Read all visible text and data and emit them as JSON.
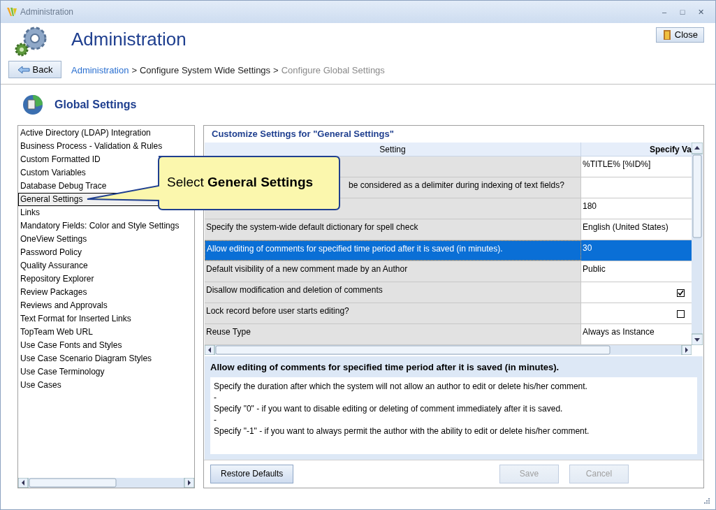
{
  "window": {
    "title": "Administration",
    "buttons": [
      "–",
      "□",
      "✕"
    ]
  },
  "header": {
    "title": "Administration",
    "close_button": "Close",
    "back_button": "Back"
  },
  "breadcrumb": [
    {
      "label": "Administration",
      "kind": "link"
    },
    {
      "label": ">",
      "kind": "sep"
    },
    {
      "label": "Configure System Wide Settings",
      "kind": "text"
    },
    {
      "label": ">",
      "kind": "sep"
    },
    {
      "label": "Configure Global Settings",
      "kind": "current"
    }
  ],
  "section_title": "Global Settings",
  "sidebar": {
    "items": [
      {
        "label": "Active Directory (LDAP) Integration",
        "selected": false
      },
      {
        "label": "Business Process - Validation & Rules",
        "selected": false
      },
      {
        "label": "Custom Formatted ID",
        "selected": false
      },
      {
        "label": "Custom Variables",
        "selected": false
      },
      {
        "label": "Database Debug Trace",
        "selected": false
      },
      {
        "label": "General Settings",
        "selected": true
      },
      {
        "label": "Links",
        "selected": false
      },
      {
        "label": "Mandatory Fields: Color and Style Settings",
        "selected": false
      },
      {
        "label": "OneView Settings",
        "selected": false
      },
      {
        "label": "Password Policy",
        "selected": false
      },
      {
        "label": "Quality Assurance",
        "selected": false
      },
      {
        "label": "Repository Explorer",
        "selected": false
      },
      {
        "label": "Review Packages",
        "selected": false
      },
      {
        "label": "Reviews and Approvals",
        "selected": false
      },
      {
        "label": "Text Format for Inserted Links",
        "selected": false
      },
      {
        "label": "TopTeam Web URL",
        "selected": false
      },
      {
        "label": "Use Case Fonts and Styles",
        "selected": false
      },
      {
        "label": "Use Case Scenario Diagram Styles",
        "selected": false
      },
      {
        "label": "Use Case Terminology",
        "selected": false
      },
      {
        "label": "Use Cases",
        "selected": false
      }
    ]
  },
  "panel_title": "Customize Settings for \"General Settings\"",
  "table": {
    "columns": [
      "Setting",
      "Specify Va"
    ],
    "rows": [
      {
        "kind": "text",
        "value": "%TITLE% [%ID%]",
        "selected": false
      },
      {
        "kind": "text",
        "setting": "be considered as a delimiter during indexing of text fields?",
        "partly_covered": true,
        "selected": false
      },
      {
        "kind": "text",
        "value": "180",
        "selected": false
      },
      {
        "kind": "text",
        "setting": "Specify the system-wide default dictionary for spell check",
        "value": "English (United States)",
        "selected": false
      },
      {
        "kind": "text",
        "setting": "Allow editing of comments for specified time period after it is saved (in minutes).",
        "value": "30",
        "selected": true
      },
      {
        "kind": "text",
        "setting": "Default visibility of a new comment made by an Author",
        "value": "Public",
        "selected": false
      },
      {
        "kind": "check",
        "setting": "Disallow modification and deletion of comments",
        "checked": true,
        "selected": false
      },
      {
        "kind": "check",
        "setting": "Lock record before user starts editing?",
        "checked": false,
        "selected": false
      },
      {
        "kind": "text",
        "setting": "Reuse Type",
        "value": "Always as Instance",
        "selected": false
      }
    ]
  },
  "description": {
    "title": "Allow editing of comments for specified time period after it is saved (in minutes).",
    "lines": [
      "Specify the duration after which the system will not allow an author to edit or delete his/her comment.",
      "-",
      "Specify \"0\" - if you want to disable editing or deleting of comment immediately after it is saved.",
      "-",
      "Specify \"-1\" - if you want to always permit the author with the ability to edit or delete his/her comment."
    ]
  },
  "buttons": [
    {
      "label": "Restore Defaults",
      "disabled": false
    },
    {
      "label": "Save",
      "disabled": true
    },
    {
      "label": "Cancel",
      "disabled": true
    }
  ],
  "callout": {
    "prefix": "Select",
    "bold": "General Settings"
  }
}
